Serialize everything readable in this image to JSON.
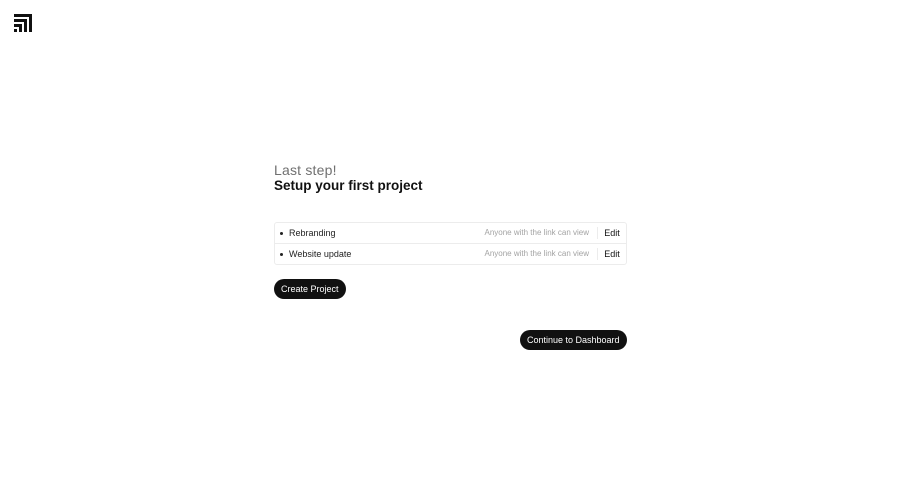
{
  "brand": {
    "logo_icon": "brand-logo-icon"
  },
  "onboarding": {
    "subtitle": "Last step!",
    "title": "Setup your first project"
  },
  "projects": [
    {
      "name": "Rebranding",
      "visibility": "Anyone with the link can view",
      "edit_label": "Edit"
    },
    {
      "name": "Website update",
      "visibility": "Anyone with the link can view",
      "edit_label": "Edit"
    }
  ],
  "actions": {
    "create_label": "Create Project",
    "continue_label": "Continue to Dashboard"
  },
  "colors": {
    "button_bg": "#111111",
    "muted_text": "#a3a3a3",
    "border": "#ececec"
  }
}
